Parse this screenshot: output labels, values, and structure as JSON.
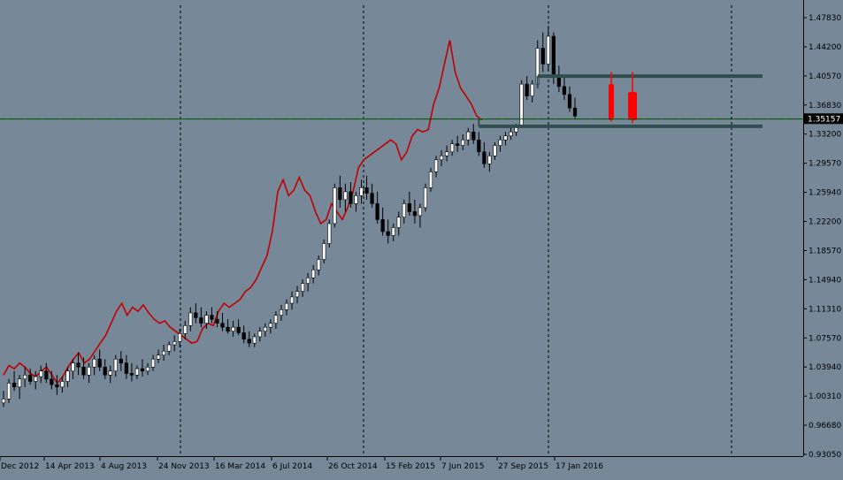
{
  "colors": {
    "background": "#778899",
    "axis": "#000000",
    "candle_up_fill": "#ffffff",
    "candle_down_fill": "#000000",
    "candle_outline": "#000000",
    "comparison_line": "#c00000",
    "bid_line": "#00d000",
    "level_lines": "#2f4f4f",
    "price_label_bg": "#000000",
    "price_label_text": "#ffffff",
    "signal_candles": "#ff0000"
  },
  "chart_data": {
    "type": "candlestick",
    "y_axis_ticks": [
      "1.47830",
      "1.44200",
      "1.40570",
      "1.36830",
      "1.33200",
      "1.29570",
      "1.25940",
      "1.22200",
      "1.18570",
      "1.14940",
      "1.11310",
      "1.07570",
      "1.03940",
      "1.00310",
      "0.96680",
      "0.93050"
    ],
    "x_axis_ticks": [
      "Dec 2012",
      "14 Apr 2013",
      "4 Aug 2013",
      "24 Nov 2013",
      "16 Mar 2014",
      "6 Jul 2014",
      "26 Oct 2014",
      "15 Feb 2015",
      "7 Jun 2015",
      "27 Sep 2015",
      "17 Jan 2016"
    ],
    "ylim": [
      0.9305,
      1.4783
    ],
    "current_price": "1.35157",
    "current_price_value": 1.35157,
    "grid": "vertical dashed lines at selected dates",
    "candles_ohlc": [
      [
        0.995,
        1.01,
        0.99,
        1.0
      ],
      [
        1.0,
        1.025,
        0.995,
        1.02
      ],
      [
        1.02,
        1.035,
        1.01,
        1.015
      ],
      [
        1.015,
        1.03,
        1.0,
        1.025
      ],
      [
        1.025,
        1.04,
        1.015,
        1.03
      ],
      [
        1.03,
        1.038,
        1.018,
        1.022
      ],
      [
        1.022,
        1.035,
        1.012,
        1.028
      ],
      [
        1.028,
        1.042,
        1.02,
        1.035
      ],
      [
        1.035,
        1.045,
        1.02,
        1.025
      ],
      [
        1.025,
        1.035,
        1.012,
        1.018
      ],
      [
        1.018,
        1.03,
        1.005,
        1.015
      ],
      [
        1.015,
        1.028,
        1.008,
        1.022
      ],
      [
        1.022,
        1.04,
        1.015,
        1.035
      ],
      [
        1.035,
        1.05,
        1.025,
        1.045
      ],
      [
        1.045,
        1.058,
        1.03,
        1.04
      ],
      [
        1.04,
        1.052,
        1.025,
        1.03
      ],
      [
        1.03,
        1.045,
        1.02,
        1.04
      ],
      [
        1.04,
        1.055,
        1.03,
        1.05
      ],
      [
        1.05,
        1.062,
        1.035,
        1.04
      ],
      [
        1.04,
        1.05,
        1.025,
        1.03
      ],
      [
        1.03,
        1.042,
        1.02,
        1.035
      ],
      [
        1.035,
        1.055,
        1.028,
        1.05
      ],
      [
        1.05,
        1.06,
        1.035,
        1.045
      ],
      [
        1.045,
        1.055,
        1.025,
        1.032
      ],
      [
        1.032,
        1.045,
        1.022,
        1.03
      ],
      [
        1.03,
        1.042,
        1.025,
        1.038
      ],
      [
        1.038,
        1.05,
        1.028,
        1.035
      ],
      [
        1.035,
        1.045,
        1.03,
        1.04
      ],
      [
        1.04,
        1.055,
        1.035,
        1.05
      ],
      [
        1.05,
        1.062,
        1.045,
        1.055
      ],
      [
        1.055,
        1.068,
        1.048,
        1.06
      ],
      [
        1.06,
        1.072,
        1.055,
        1.068
      ],
      [
        1.068,
        1.08,
        1.06,
        1.072
      ],
      [
        1.072,
        1.088,
        1.065,
        1.082
      ],
      [
        1.082,
        1.098,
        1.075,
        1.092
      ],
      [
        1.092,
        1.115,
        1.085,
        1.108
      ],
      [
        1.108,
        1.12,
        1.095,
        1.102
      ],
      [
        1.102,
        1.115,
        1.09,
        1.095
      ],
      [
        1.095,
        1.11,
        1.088,
        1.105
      ],
      [
        1.105,
        1.115,
        1.095,
        1.1
      ],
      [
        1.1,
        1.11,
        1.09,
        1.095
      ],
      [
        1.095,
        1.108,
        1.085,
        1.09
      ],
      [
        1.09,
        1.1,
        1.082,
        1.085
      ],
      [
        1.085,
        1.098,
        1.078,
        1.09
      ],
      [
        1.09,
        1.1,
        1.08,
        1.083
      ],
      [
        1.083,
        1.092,
        1.07,
        1.075
      ],
      [
        1.075,
        1.085,
        1.065,
        1.07
      ],
      [
        1.07,
        1.082,
        1.065,
        1.078
      ],
      [
        1.078,
        1.09,
        1.072,
        1.085
      ],
      [
        1.085,
        1.095,
        1.078,
        1.09
      ],
      [
        1.09,
        1.1,
        1.082,
        1.095
      ],
      [
        1.095,
        1.11,
        1.088,
        1.105
      ],
      [
        1.105,
        1.118,
        1.098,
        1.112
      ],
      [
        1.112,
        1.125,
        1.105,
        1.12
      ],
      [
        1.12,
        1.135,
        1.112,
        1.128
      ],
      [
        1.128,
        1.142,
        1.12,
        1.135
      ],
      [
        1.135,
        1.15,
        1.128,
        1.145
      ],
      [
        1.145,
        1.158,
        1.135,
        1.152
      ],
      [
        1.152,
        1.168,
        1.145,
        1.162
      ],
      [
        1.162,
        1.18,
        1.155,
        1.175
      ],
      [
        1.175,
        1.2,
        1.17,
        1.195
      ],
      [
        1.195,
        1.225,
        1.19,
        1.22
      ],
      [
        1.22,
        1.27,
        1.215,
        1.265
      ],
      [
        1.265,
        1.28,
        1.24,
        1.25
      ],
      [
        1.25,
        1.27,
        1.235,
        1.26
      ],
      [
        1.26,
        1.272,
        1.24,
        1.245
      ],
      [
        1.245,
        1.26,
        1.235,
        1.255
      ],
      [
        1.255,
        1.275,
        1.245,
        1.265
      ],
      [
        1.265,
        1.28,
        1.25,
        1.258
      ],
      [
        1.258,
        1.27,
        1.24,
        1.245
      ],
      [
        1.245,
        1.26,
        1.22,
        1.225
      ],
      [
        1.225,
        1.24,
        1.205,
        1.21
      ],
      [
        1.21,
        1.225,
        1.195,
        1.205
      ],
      [
        1.205,
        1.22,
        1.198,
        1.215
      ],
      [
        1.215,
        1.235,
        1.205,
        1.228
      ],
      [
        1.228,
        1.25,
        1.22,
        1.245
      ],
      [
        1.245,
        1.26,
        1.23,
        1.235
      ],
      [
        1.235,
        1.25,
        1.22,
        1.23
      ],
      [
        1.23,
        1.245,
        1.215,
        1.24
      ],
      [
        1.24,
        1.27,
        1.235,
        1.265
      ],
      [
        1.265,
        1.29,
        1.26,
        1.285
      ],
      [
        1.285,
        1.305,
        1.278,
        1.3
      ],
      [
        1.3,
        1.312,
        1.292,
        1.305
      ],
      [
        1.305,
        1.318,
        1.298,
        1.31
      ],
      [
        1.31,
        1.325,
        1.305,
        1.32
      ],
      [
        1.32,
        1.33,
        1.31,
        1.318
      ],
      [
        1.318,
        1.332,
        1.312,
        1.325
      ],
      [
        1.325,
        1.34,
        1.318,
        1.335
      ],
      [
        1.335,
        1.345,
        1.32,
        1.325
      ],
      [
        1.325,
        1.335,
        1.305,
        1.31
      ],
      [
        1.31,
        1.322,
        1.29,
        1.295
      ],
      [
        1.295,
        1.31,
        1.285,
        1.305
      ],
      [
        1.305,
        1.322,
        1.3,
        1.318
      ],
      [
        1.318,
        1.33,
        1.31,
        1.325
      ],
      [
        1.325,
        1.335,
        1.318,
        1.33
      ],
      [
        1.33,
        1.342,
        1.325,
        1.335
      ],
      [
        1.335,
        1.345,
        1.33,
        1.342
      ],
      [
        1.342,
        1.4,
        1.34,
        1.395
      ],
      [
        1.395,
        1.405,
        1.375,
        1.38
      ],
      [
        1.38,
        1.4,
        1.372,
        1.395
      ],
      [
        1.395,
        1.45,
        1.39,
        1.44
      ],
      [
        1.44,
        1.46,
        1.41,
        1.42
      ],
      [
        1.42,
        1.468,
        1.412,
        1.455
      ],
      [
        1.455,
        1.46,
        1.395,
        1.405
      ],
      [
        1.405,
        1.418,
        1.385,
        1.392
      ],
      [
        1.392,
        1.405,
        1.375,
        1.382
      ],
      [
        1.382,
        1.392,
        1.36,
        1.365
      ],
      [
        1.365,
        1.378,
        1.352,
        1.355
      ]
    ],
    "comparison_line": [
      1.03,
      1.042,
      1.038,
      1.045,
      1.04,
      1.032,
      1.028,
      1.035,
      1.04,
      1.03,
      1.02,
      1.028,
      1.04,
      1.05,
      1.058,
      1.045,
      1.05,
      1.06,
      1.07,
      1.08,
      1.095,
      1.11,
      1.12,
      1.105,
      1.115,
      1.11,
      1.118,
      1.108,
      1.1,
      1.095,
      1.098,
      1.09,
      1.085,
      1.08,
      1.075,
      1.07,
      1.072,
      1.088,
      1.095,
      1.092,
      1.11,
      1.12,
      1.115,
      1.12,
      1.125,
      1.135,
      1.14,
      1.15,
      1.165,
      1.18,
      1.21,
      1.26,
      1.275,
      1.255,
      1.262,
      1.278,
      1.262,
      1.255,
      1.235,
      1.22,
      1.225,
      1.245,
      1.235,
      1.225,
      1.24,
      1.26,
      1.29,
      1.3,
      1.305,
      1.31,
      1.315,
      1.32,
      1.325,
      1.32,
      1.3,
      1.31,
      1.33,
      1.338,
      1.335,
      1.338,
      1.37,
      1.39,
      1.42,
      1.45,
      1.41,
      1.39,
      1.38,
      1.37,
      1.355,
      1.35
    ],
    "levels": [
      {
        "value": 1.405,
        "from_candle": 100
      },
      {
        "value": 1.342,
        "from_candle": 89
      }
    ],
    "signal_candles": [
      {
        "open": 1.395,
        "close": 1.35,
        "high": 1.41,
        "low": 1.348
      },
      {
        "open": 1.385,
        "close": 1.35,
        "high": 1.41,
        "low": 1.346
      }
    ]
  }
}
